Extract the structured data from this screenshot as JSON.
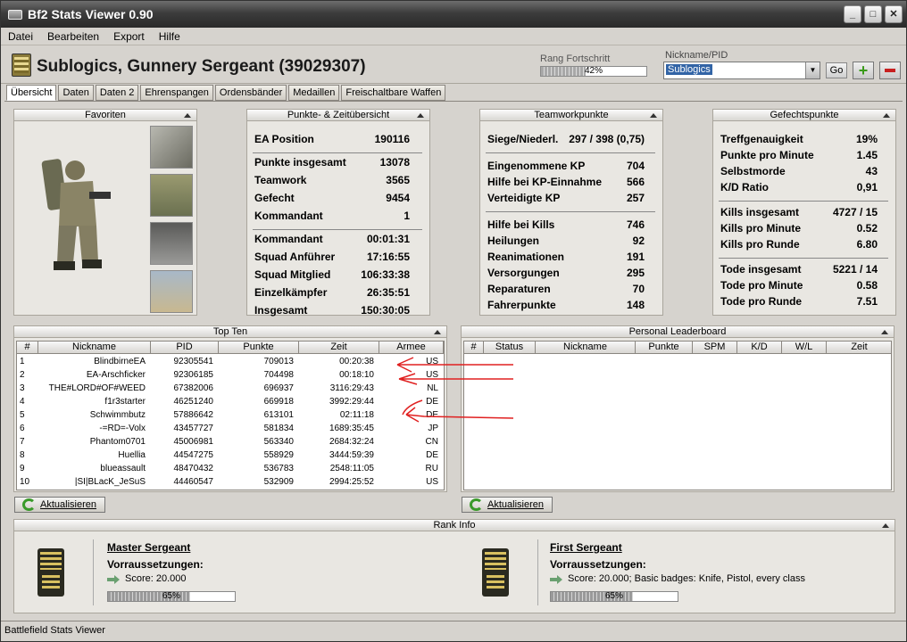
{
  "window": {
    "title": "Bf2 Stats Viewer 0.90"
  },
  "menu": [
    "Datei",
    "Bearbeiten",
    "Export",
    "Hilfe"
  ],
  "header": {
    "player_title": "Sublogics, Gunnery Sergeant (39029307)",
    "rank_progress_label": "Rang Fortschritt",
    "rank_progress_text": "42%",
    "rank_progress_value": 0.42,
    "nickname_label": "Nickname/PID",
    "nickname_value": "Sublogics",
    "go_label": "Go"
  },
  "tabs": [
    "Übersicht",
    "Daten",
    "Daten 2",
    "Ehrenspangen",
    "Ordensbänder",
    "Medaillen",
    "Freischaltbare Waffen"
  ],
  "favoriten": {
    "title": "Favoriten"
  },
  "punkte": {
    "title": "Punkte- & Zeitübersicht",
    "group1": [
      {
        "label": "EA Position",
        "value": "190116"
      }
    ],
    "group2": [
      {
        "label": "Punkte insgesamt",
        "value": "13078"
      },
      {
        "label": "Teamwork",
        "value": "3565"
      },
      {
        "label": "Gefecht",
        "value": "9454"
      },
      {
        "label": "Kommandant",
        "value": "1"
      }
    ],
    "group3": [
      {
        "label": "Kommandant",
        "value": "00:01:31"
      },
      {
        "label": "Squad Anführer",
        "value": "17:16:55"
      },
      {
        "label": "Squad Mitglied",
        "value": "106:33:38"
      },
      {
        "label": "Einzelkämpfer",
        "value": "26:35:51"
      },
      {
        "label": "Insgesamt",
        "value": "150:30:05"
      }
    ]
  },
  "teamwork": {
    "title": "Teamworkpunkte",
    "group1": [
      {
        "label": "Siege/Niederl.",
        "value": "297 / 398 (0,75)"
      }
    ],
    "group2": [
      {
        "label": "Eingenommene KP",
        "value": "704"
      },
      {
        "label": "Hilfe bei KP-Einnahme",
        "value": "566"
      },
      {
        "label": "Verteidigte KP",
        "value": "257"
      }
    ],
    "group3": [
      {
        "label": "Hilfe bei Kills",
        "value": "746"
      },
      {
        "label": "Heilungen",
        "value": "92"
      },
      {
        "label": "Reanimationen",
        "value": "191"
      },
      {
        "label": "Versorgungen",
        "value": "295"
      },
      {
        "label": "Reparaturen",
        "value": "70"
      },
      {
        "label": "Fahrerpunkte",
        "value": "148"
      }
    ]
  },
  "gefecht": {
    "title": "Gefechtspunkte",
    "group1": [
      {
        "label": "Treffgenauigkeit",
        "value": "19%"
      },
      {
        "label": "Punkte pro Minute",
        "value": "1.45"
      },
      {
        "label": "Selbstmorde",
        "value": "43"
      },
      {
        "label": "K/D Ratio",
        "value": "0,91"
      }
    ],
    "group2": [
      {
        "label": "Kills insgesamt",
        "value": "4727 / 15"
      },
      {
        "label": "Kills pro Minute",
        "value": "0.52"
      },
      {
        "label": "Kills pro Runde",
        "value": "6.80"
      }
    ],
    "group3": [
      {
        "label": "Tode insgesamt",
        "value": "5221 / 14"
      },
      {
        "label": "Tode pro Minute",
        "value": "0.58"
      },
      {
        "label": "Tode pro Runde",
        "value": "7.51"
      }
    ]
  },
  "topten": {
    "title": "Top Ten",
    "columns": [
      "#",
      "Nickname",
      "PID",
      "Punkte",
      "Zeit",
      "Armee"
    ],
    "rows": [
      [
        "1",
        "BlindbirneEA",
        "92305541",
        "709013",
        "00:20:38",
        "US"
      ],
      [
        "2",
        "EA-Arschficker",
        "92306185",
        "704498",
        "00:18:10",
        "US"
      ],
      [
        "3",
        "THE#LORD#OF#WEED",
        "67382006",
        "696937",
        "3116:29:43",
        "NL"
      ],
      [
        "4",
        "f1r3starter",
        "46251240",
        "669918",
        "3992:29:44",
        "DE"
      ],
      [
        "5",
        "Schwimmbutz",
        "57886642",
        "613101",
        "02:11:18",
        "DE"
      ],
      [
        "6",
        "-=RD=-Volx",
        "43457727",
        "581834",
        "1689:35:45",
        "JP"
      ],
      [
        "7",
        "Phantom0701",
        "45006981",
        "563340",
        "2684:32:24",
        "CN"
      ],
      [
        "8",
        "Huellia",
        "44547275",
        "558929",
        "3444:59:39",
        "DE"
      ],
      [
        "9",
        "blueassault",
        "48470432",
        "536783",
        "2548:11:05",
        "RU"
      ],
      [
        "10",
        "|SI|BLacK_JeSuS",
        "44460547",
        "532909",
        "2994:25:52",
        "US"
      ]
    ],
    "refresh_label": "Aktualisieren"
  },
  "leaderboard": {
    "title": "Personal Leaderboard",
    "columns": [
      "#",
      "Status",
      "Nickname",
      "Punkte",
      "SPM",
      "K/D",
      "W/L",
      "Zeit"
    ],
    "refresh_label": "Aktualisieren"
  },
  "rankinfo": {
    "title": "Rank Info",
    "left": {
      "name": "Master Sergeant",
      "req_label": "Vorraussetzungen:",
      "score": "Score: 20.000",
      "progress_text": "65%",
      "progress_value": 0.65
    },
    "right": {
      "name": "First Sergeant",
      "req_label": "Vorraussetzungen:",
      "score": "Score: 20.000; Basic badges: Knife, Pistol, every class",
      "progress_text": "65%",
      "progress_value": 0.65
    }
  },
  "statusbar": {
    "text": "Battlefield Stats Viewer"
  }
}
